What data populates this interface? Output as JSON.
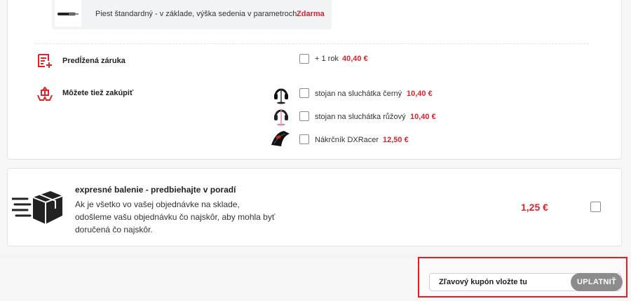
{
  "option": {
    "label": "Piest štandardný - v základe, výška sedenia v parametroch",
    "price": "Zdarma"
  },
  "warranty": {
    "title": "Predĺžená záruka",
    "option_label": "+ 1 rok",
    "option_price": "40,40 €"
  },
  "extras": {
    "title": "Môžete tiež zakúpiť",
    "items": [
      {
        "label": "stojan na sluchátka černý",
        "price": "10,40 €"
      },
      {
        "label": "stojan na sluchátka růžový",
        "price": "10,40 €"
      },
      {
        "label": "Nákrčník DXRacer",
        "price": "12,50 €"
      }
    ]
  },
  "express": {
    "title": "expresné balenie - predbiehajte v poradí",
    "description": "Ak je všetko vo vašej objednávke na sklade, odošleme vašu objednávku čo najskôr, aby mohla byť doručená čo najskôr.",
    "price": "1,25 €"
  },
  "coupon": {
    "placeholder": "Zľavový kupón vložte tu",
    "button_label": "UPLATNIŤ"
  },
  "colors": {
    "accent_red": "#d9232d",
    "highlight_border": "#e31e24",
    "button_gray": "#8c8c8c"
  }
}
